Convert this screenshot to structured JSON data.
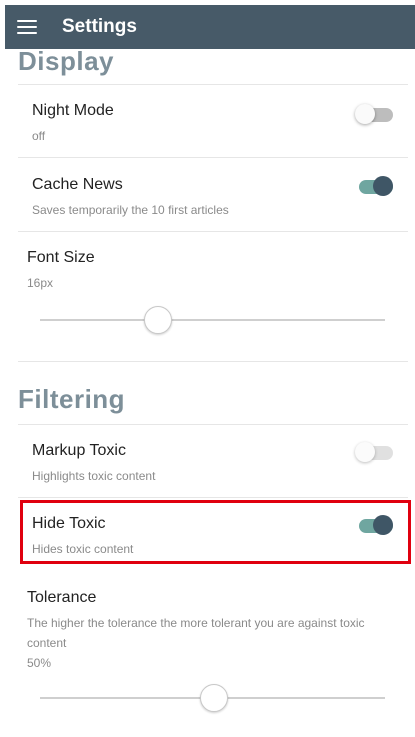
{
  "appbar": {
    "title": "Settings",
    "menu_icon": "menu-icon"
  },
  "display": {
    "title": "Display",
    "night_mode": {
      "label": "Night Mode",
      "summary": "off",
      "enabled": false
    },
    "cache_news": {
      "label": "Cache News",
      "summary": "Saves temporarily the 10 first articles",
      "enabled": true
    },
    "font_size": {
      "label": "Font Size",
      "value": "16px",
      "slider_fraction": 0.34
    }
  },
  "filtering": {
    "title": "Filtering",
    "markup_toxic": {
      "label": "Markup Toxic",
      "summary": "Highlights toxic content",
      "enabled": false
    },
    "hide_toxic": {
      "label": "Hide Toxic",
      "summary": "Hides toxic content",
      "enabled": true
    },
    "tolerance": {
      "label": "Tolerance",
      "summary": "The higher the tolerance the more tolerant you are against toxic content",
      "value": "50%",
      "slider_fraction": 0.5
    }
  },
  "colors": {
    "appbar": "#475a68",
    "section_title": "#7d8f99",
    "toggle_on_track": "#6fa6a0",
    "toggle_on_thumb": "#3f5666",
    "highlight": "#e0000f"
  }
}
